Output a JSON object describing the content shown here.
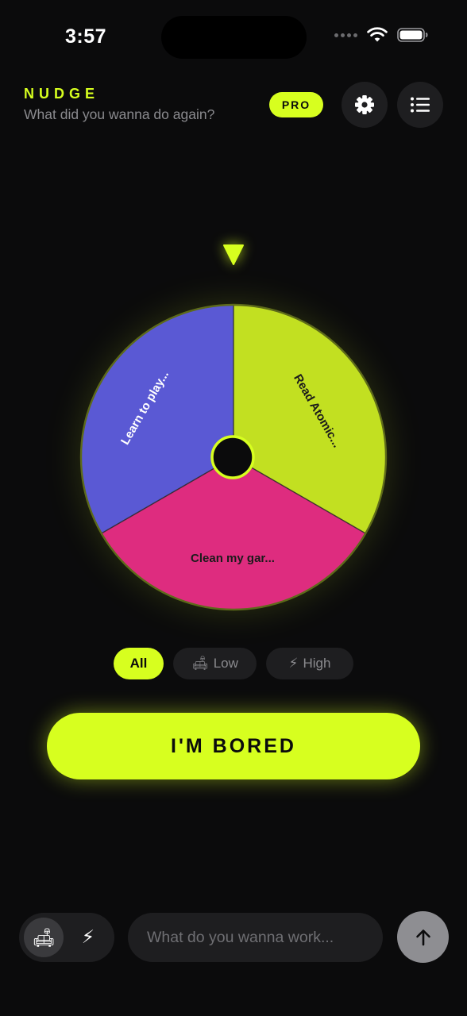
{
  "status_bar": {
    "time": "3:57"
  },
  "header": {
    "title": "NUDGE",
    "subtitle": "What did you wanna do again?",
    "pro_badge": "PRO",
    "settings_icon": "gear-icon",
    "list_icon": "list-icon"
  },
  "wheel": {
    "segments": [
      {
        "label": "Read Atomic...",
        "color": "#c2e021",
        "text_color": "#1b1b1b"
      },
      {
        "label": "Clean my gar...",
        "color": "#de2c7f",
        "text_color": "#1b1b1b"
      },
      {
        "label": "Learn to play...",
        "color": "#5a59d4",
        "text_color": "#ffffff"
      }
    ],
    "hub_color": "#0b0b0c",
    "accent": "#d7ff1f"
  },
  "filters": {
    "all": "All",
    "low": "Low",
    "low_emoji": "🛋",
    "high": "High",
    "high_emoji": "⚡",
    "selected": "All"
  },
  "main_button": {
    "label": "I'M BORED"
  },
  "composer": {
    "mode_low_emoji": "🛋",
    "mode_high_emoji": "⚡",
    "selected_mode": "low",
    "placeholder": "What do you wanna work...",
    "send_icon": "arrow-up-icon"
  },
  "colors": {
    "accent": "#d7ff1f",
    "background": "#0b0b0c",
    "surface": "#1e1e20",
    "muted_text": "#8a8a8e"
  }
}
